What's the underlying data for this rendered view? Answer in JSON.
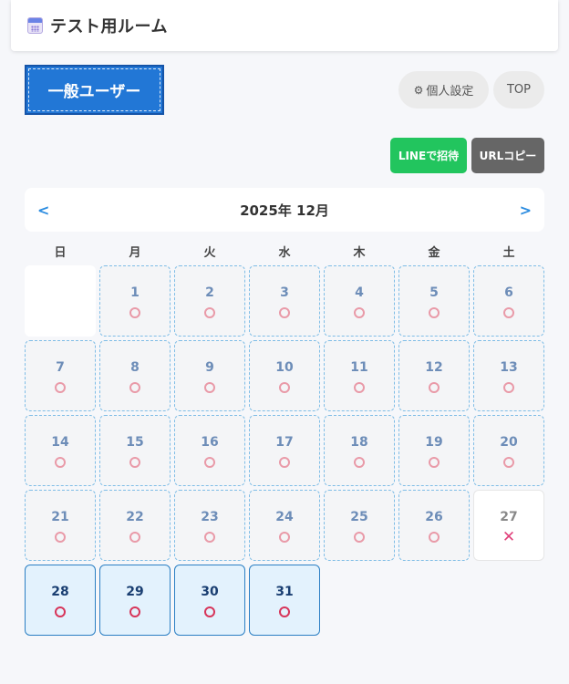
{
  "header": {
    "title": "テスト用ルーム",
    "icon": "calendar-icon"
  },
  "user_badge": "一般ユーザー",
  "buttons": {
    "settings_label": "個人設定",
    "settings_icon": "⚙",
    "top_label": "TOP",
    "line_invite_label": "LINEで招待",
    "url_copy_label": "URLコピー"
  },
  "calendar": {
    "month_label": "2025年 12月",
    "prev_label": "<",
    "next_label": ">",
    "weekdays": [
      "日",
      "月",
      "火",
      "水",
      "木",
      "金",
      "土"
    ],
    "available_mark": "○",
    "unavailable_mark": "✕",
    "colors": {
      "accent": "#2277d6",
      "line_green": "#22c55e",
      "circle": "#e99aa8",
      "cross": "#e0407a",
      "highlight_bg": "#e3f2fd"
    },
    "days": [
      {
        "day": "",
        "status": "blank",
        "mark": ""
      },
      {
        "day": "1",
        "status": "available",
        "mark": "○"
      },
      {
        "day": "2",
        "status": "available",
        "mark": "○"
      },
      {
        "day": "3",
        "status": "available",
        "mark": "○"
      },
      {
        "day": "4",
        "status": "available",
        "mark": "○"
      },
      {
        "day": "5",
        "status": "available",
        "mark": "○"
      },
      {
        "day": "6",
        "status": "available",
        "mark": "○"
      },
      {
        "day": "7",
        "status": "available",
        "mark": "○"
      },
      {
        "day": "8",
        "status": "available",
        "mark": "○"
      },
      {
        "day": "9",
        "status": "available",
        "mark": "○"
      },
      {
        "day": "10",
        "status": "available",
        "mark": "○"
      },
      {
        "day": "11",
        "status": "available",
        "mark": "○"
      },
      {
        "day": "12",
        "status": "available",
        "mark": "○"
      },
      {
        "day": "13",
        "status": "available",
        "mark": "○"
      },
      {
        "day": "14",
        "status": "available",
        "mark": "○"
      },
      {
        "day": "15",
        "status": "available",
        "mark": "○"
      },
      {
        "day": "16",
        "status": "available",
        "mark": "○"
      },
      {
        "day": "17",
        "status": "available",
        "mark": "○"
      },
      {
        "day": "18",
        "status": "available",
        "mark": "○"
      },
      {
        "day": "19",
        "status": "available",
        "mark": "○"
      },
      {
        "day": "20",
        "status": "available",
        "mark": "○"
      },
      {
        "day": "21",
        "status": "available",
        "mark": "○"
      },
      {
        "day": "22",
        "status": "available",
        "mark": "○"
      },
      {
        "day": "23",
        "status": "available",
        "mark": "○"
      },
      {
        "day": "24",
        "status": "available",
        "mark": "○"
      },
      {
        "day": "25",
        "status": "available",
        "mark": "○"
      },
      {
        "day": "26",
        "status": "available",
        "mark": "○"
      },
      {
        "day": "27",
        "status": "unavailable",
        "mark": "✕"
      },
      {
        "day": "28",
        "status": "highlight",
        "mark": "○"
      },
      {
        "day": "29",
        "status": "highlight",
        "mark": "○"
      },
      {
        "day": "30",
        "status": "highlight",
        "mark": "○"
      },
      {
        "day": "31",
        "status": "highlight",
        "mark": "○"
      }
    ]
  }
}
